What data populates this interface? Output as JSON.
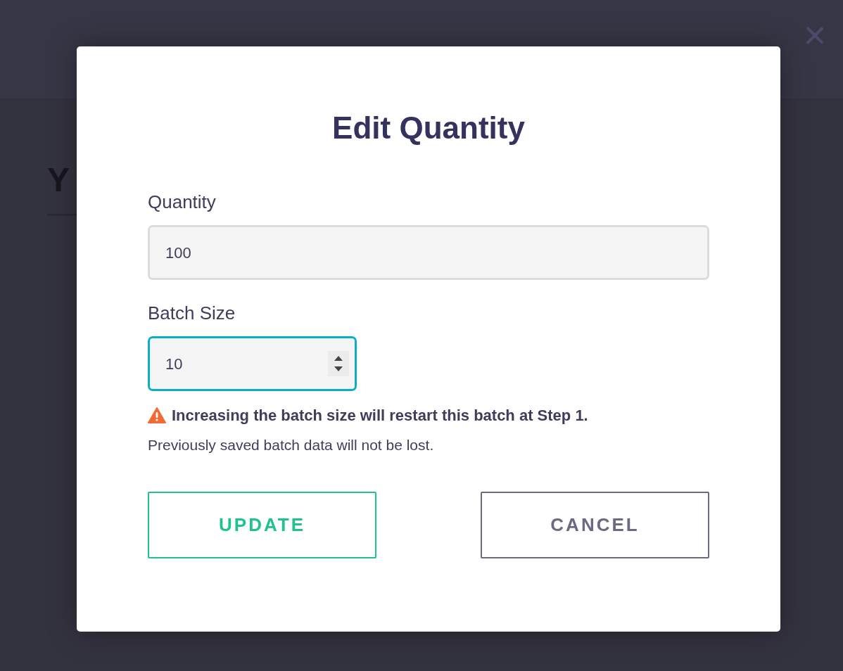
{
  "background": {
    "heading": "Y"
  },
  "close": {
    "symbol": "×"
  },
  "dialog": {
    "title": "Edit Quantity",
    "fields": [
      {
        "label": "Quantity",
        "value": "100",
        "kind": "text",
        "focused": false
      },
      {
        "label": "Batch Size",
        "value": "10",
        "kind": "number",
        "focused": true
      }
    ],
    "warning": {
      "headline": "Increasing the batch size will restart this batch at Step 1.",
      "note": "Previously saved batch data will not be lost."
    },
    "buttons": [
      {
        "label": "UPDATE",
        "kind": "primary"
      },
      {
        "label": "CANCEL",
        "kind": "secondary"
      }
    ]
  }
}
